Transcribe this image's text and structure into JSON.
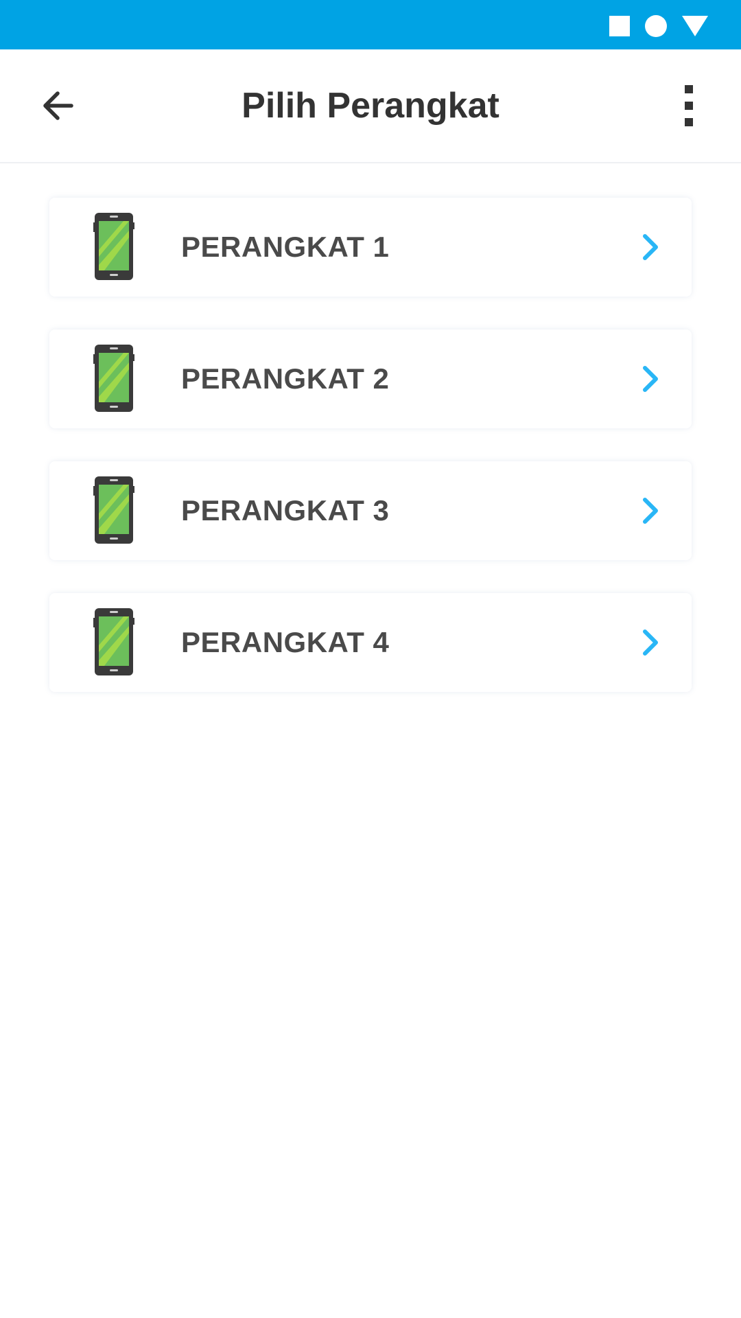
{
  "status_bar": {
    "color": "#00a3e4",
    "icons": [
      "stop-square-icon",
      "record-circle-icon",
      "signal-triangle-icon"
    ]
  },
  "header": {
    "title": "Pilih Perangkat",
    "back_icon": "arrow-left-icon",
    "menu_icon": "more-vertical-icon"
  },
  "devices": [
    {
      "label": "PERANGKAT 1",
      "icon": "smartphone-icon"
    },
    {
      "label": "PERANGKAT 2",
      "icon": "smartphone-icon"
    },
    {
      "label": "PERANGKAT 3",
      "icon": "smartphone-icon"
    },
    {
      "label": "PERANGKAT 4",
      "icon": "smartphone-icon"
    }
  ],
  "colors": {
    "accent": "#00a3e4",
    "chevron": "#29b6f6",
    "phone_screen": "#8cc63f",
    "phone_body": "#3a3a3a"
  }
}
